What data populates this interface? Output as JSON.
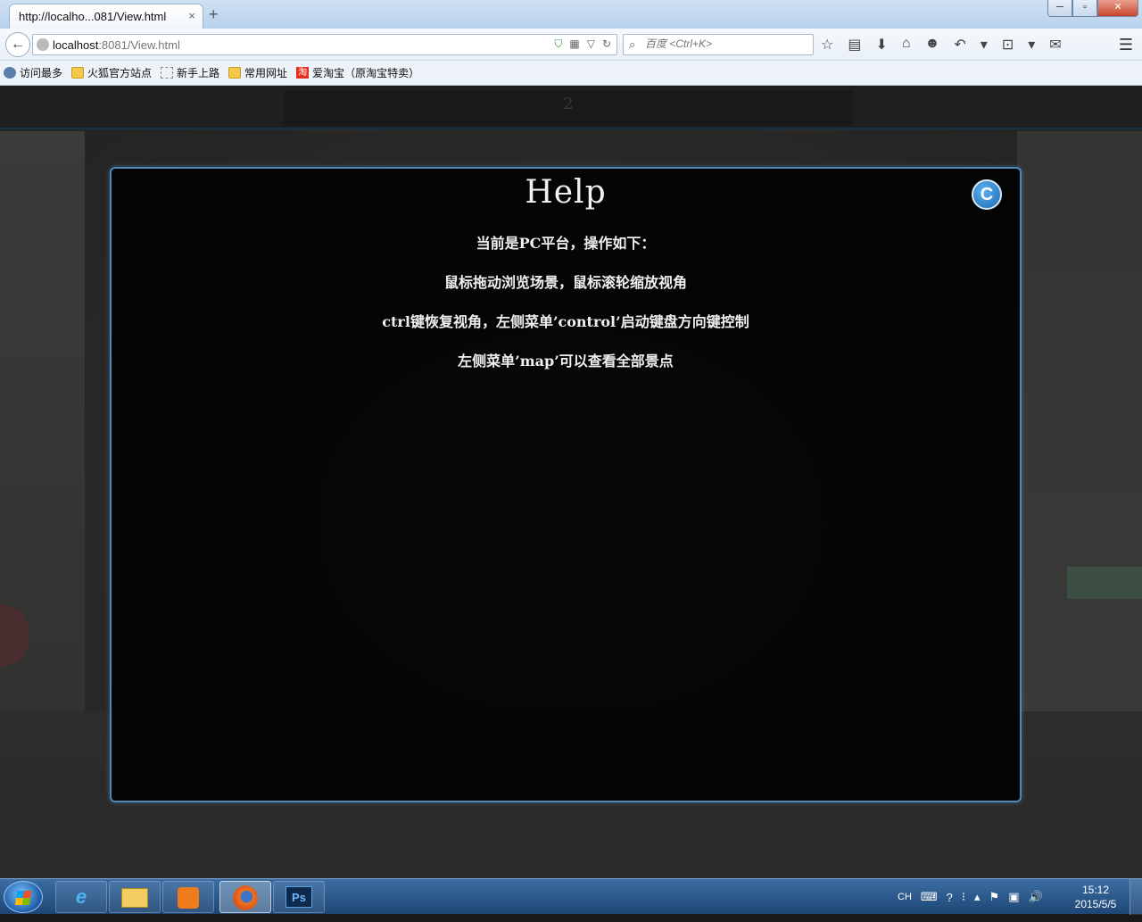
{
  "browser": {
    "tab_title": "http://localho...081/View.html",
    "tab_close": "×",
    "new_tab": "+",
    "url_host": "localhost",
    "url_rest": ":8081/View.html",
    "search_placeholder": "百度 <Ctrl+K>",
    "window_buttons": {
      "minimize": "─",
      "maximize": "▫",
      "close": "✕"
    }
  },
  "bookmarks": [
    {
      "label": "访问最多",
      "icon": "gear-icon"
    },
    {
      "label": "火狐官方站点",
      "icon": "folder-icon"
    },
    {
      "label": "新手上路",
      "icon": "page-icon"
    },
    {
      "label": "常用网址",
      "icon": "folder-icon"
    },
    {
      "label": "爱淘宝（原淘宝特卖）",
      "icon": "taobao-icon",
      "icon_text": "淘"
    }
  ],
  "page": {
    "top_title": "2"
  },
  "help": {
    "title": "Help",
    "close_label": "C",
    "lines": [
      "当前是PC平台，操作如下：",
      "鼠标拖动浏览场景，鼠标滚轮缩放视角",
      "ctrl键恢复视角，左侧菜单’control’启动键盘方向键控制",
      "左侧菜单’map’可以查看全部景点"
    ]
  },
  "taskbar": {
    "apps": [
      {
        "name": "internet-explorer",
        "label": "e"
      },
      {
        "name": "file-explorer"
      },
      {
        "name": "media-player"
      },
      {
        "name": "firefox",
        "active": true
      },
      {
        "name": "photoshop",
        "label": "Ps"
      }
    ],
    "tray": {
      "lang": "CH"
    },
    "clock_time": "15:12",
    "clock_date": "2015/5/5"
  },
  "colors": {
    "panel_border": "#4f88b5",
    "close_button": "#1a6ab3",
    "taskbar": "#1e4775"
  }
}
